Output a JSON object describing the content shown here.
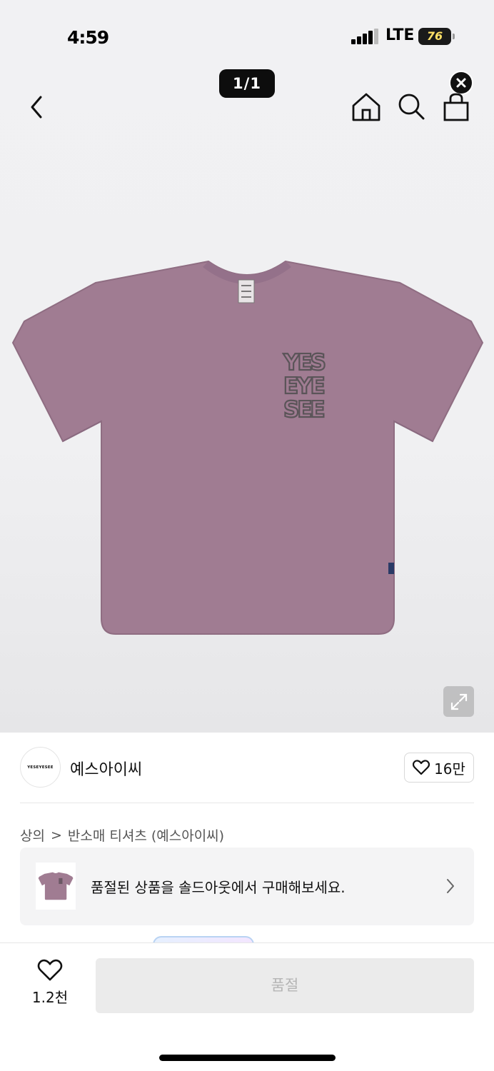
{
  "status_bar": {
    "time": "4:59",
    "network": "LTE",
    "battery": "76"
  },
  "gallery": {
    "counter": "1/1",
    "print_text": [
      "YES",
      "EYE",
      "SEE"
    ]
  },
  "brand": {
    "logo_text": "YESEYESEE",
    "name": "예스아이씨",
    "likes": "16만"
  },
  "breadcrumb": {
    "category": "상의",
    "separator": ">",
    "subcategory": "반소매 티셔츠 (예스아이씨)"
  },
  "soldout_banner": {
    "text": "품절된 상품을 솔드아웃에서 구매해보세요."
  },
  "bottom_bar": {
    "wishlist_count": "1.2천",
    "buy_label": "품절"
  },
  "colors": {
    "shirt": "#a07c92",
    "print": "#5a5458",
    "counter_bg": "#0d0d0d",
    "disabled_btn": "#ebebeb"
  },
  "icons": [
    "back-icon",
    "home-icon",
    "search-icon",
    "bag-icon",
    "close-icon",
    "expand-icon",
    "heart-icon",
    "chevron-right-icon"
  ]
}
